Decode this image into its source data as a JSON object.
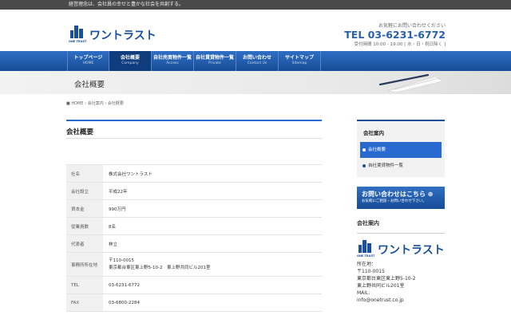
{
  "topbar": {
    "text": "経営理念は、会社員の幸せと豊かな社会を共創する。"
  },
  "logo": {
    "name": "ワントラスト",
    "sub": "ONE TRUST"
  },
  "contact": {
    "lead": "お気軽にお問い合わせください",
    "tel": "TEL 03-6231-6772",
    "hours": "受付時間 10:00 - 19:00 [ 水・日・祝日除く ]"
  },
  "nav": [
    {
      "jp": "トップページ",
      "en": "HOME"
    },
    {
      "jp": "会社概要",
      "en": "Company"
    },
    {
      "jp": "自社売買物件一覧",
      "en": "Access"
    },
    {
      "jp": "自社賃貸物件一覧",
      "en": "Private"
    },
    {
      "jp": "お問い合わせ",
      "en": "Contact Us"
    },
    {
      "jp": "サイトマップ",
      "en": "Sitemap"
    }
  ],
  "page_title": "会社概要",
  "breadcrumb": {
    "home": "HOME",
    "sep": "›",
    "c1": "会社案内",
    "c2": "会社概要"
  },
  "section_title": "会社概要",
  "table": [
    {
      "k": "社名",
      "v": [
        "株式会社ワントラスト"
      ]
    },
    {
      "k": "会社設立",
      "v": [
        "平成22年"
      ]
    },
    {
      "k": "資本金",
      "v": [
        "990万円"
      ]
    },
    {
      "k": "従業員数",
      "v": [
        "8名"
      ]
    },
    {
      "k": "代表者",
      "v": [
        "林立"
      ]
    },
    {
      "k": "事務所所在地",
      "v": [
        "〒110-0015",
        "東京都台東区東上野5-10-2　東上野共同ビル201室"
      ]
    },
    {
      "k": "TEL",
      "v": [
        "03-6231-6772"
      ]
    },
    {
      "k": "FAX",
      "v": [
        "03-6800-2284"
      ]
    }
  ],
  "sidebar": {
    "box_title": "会社案内",
    "items": [
      "会社概要",
      "自社賃貸物件一覧"
    ],
    "banner_big": "お問い合わせはこちら ⊕",
    "banner_small": "お気軽にご相談・お問い合わせ下さい。",
    "info_title": "会社案内",
    "info_lines": [
      "所在地：",
      "〒110-0015",
      "東京都台東区東上野5-10-2",
      "東上野共同ビル201室",
      "MAIL:",
      "info@onetrust.co.jp"
    ]
  }
}
